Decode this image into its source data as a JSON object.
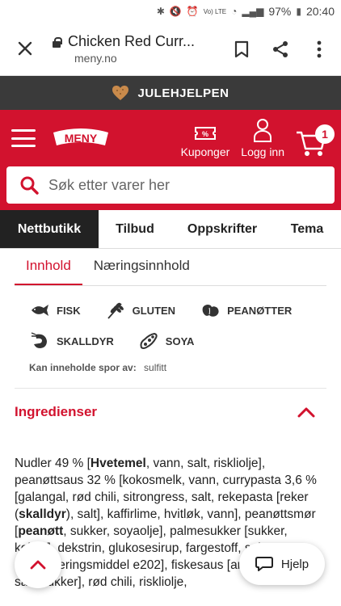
{
  "status_bar": {
    "battery": "97%",
    "time": "20:40",
    "network": "Vo) LTE"
  },
  "browser": {
    "page_title": "Chicken Red Curr...",
    "domain": "meny.no"
  },
  "banner": {
    "label": "JULEHJELPEN"
  },
  "header": {
    "logo_text": "MENY",
    "coupons_label": "Kuponger",
    "login_label": "Logg inn",
    "cart_count": "1",
    "brand_color": "#d2122e"
  },
  "search": {
    "placeholder": "Søk etter varer her"
  },
  "nav": {
    "items": [
      {
        "label": "Nettbutikk"
      },
      {
        "label": "Tilbud"
      },
      {
        "label": "Oppskrifter"
      },
      {
        "label": "Tema"
      }
    ]
  },
  "info_tabs": [
    {
      "label": "Innhold"
    },
    {
      "label": "Næringsinnhold"
    }
  ],
  "allergens": [
    {
      "label": "FISK",
      "icon": "fish-icon"
    },
    {
      "label": "GLUTEN",
      "icon": "wheat-icon"
    },
    {
      "label": "PEANØTTER",
      "icon": "peanut-icon"
    },
    {
      "label": "SKALLDYR",
      "icon": "shrimp-icon"
    },
    {
      "label": "SOYA",
      "icon": "soy-icon"
    }
  ],
  "traces": {
    "label": "Kan inneholde spor av:",
    "value": "sulfitt"
  },
  "ingredients": {
    "title": "Ingredienser",
    "text_parts": [
      "Nudler 49 % [",
      "Hvetemel",
      ", vann, salt, riskliolje], peanøttsaus 32 % [kokosmelk, vann, currypasta 3,6 % [galangal, rød chili, sitrongress, salt, rekepasta [reker (",
      "skalldyr",
      "), salt], kaffirlime, hvitløk, vann], peanøttsmør [",
      "peanøtt",
      ", sukker, soyaolje], palmesukker [sukker, kokos], dekstrin, glukosesirup, fargestoff, salt, konserveringsmiddel e202], fiskesaus [ansjos (",
      "fisk",
      "), salt, sukker], rød chili, riskliolje,"
    ]
  },
  "help": {
    "label": "Hjelp"
  }
}
